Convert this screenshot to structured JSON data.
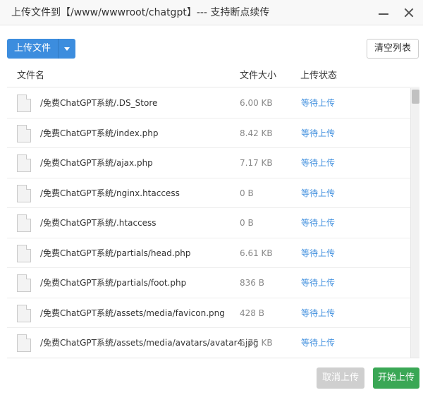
{
  "window": {
    "title": "上传文件到【/www/wwwroot/chatgpt】--- 支持断点续传"
  },
  "toolbar": {
    "upload_label": "上传文件",
    "clear_label": "清空列表"
  },
  "table": {
    "headers": {
      "name": "文件名",
      "size": "文件大小",
      "status": "上传状态"
    },
    "rows": [
      {
        "name": "/免费ChatGPT系统/.DS_Store",
        "size": "6.00 KB",
        "status": "等待上传"
      },
      {
        "name": "/免费ChatGPT系统/index.php",
        "size": "8.42 KB",
        "status": "等待上传"
      },
      {
        "name": "/免费ChatGPT系统/ajax.php",
        "size": "7.17 KB",
        "status": "等待上传"
      },
      {
        "name": "/免费ChatGPT系统/nginx.htaccess",
        "size": "0 B",
        "status": "等待上传"
      },
      {
        "name": "/免费ChatGPT系统/.htaccess",
        "size": "0 B",
        "status": "等待上传"
      },
      {
        "name": "/免费ChatGPT系统/partials/head.php",
        "size": "6.61 KB",
        "status": "等待上传"
      },
      {
        "name": "/免费ChatGPT系统/partials/foot.php",
        "size": "836 B",
        "status": "等待上传"
      },
      {
        "name": "/免费ChatGPT系统/assets/media/favicon.png",
        "size": "428 B",
        "status": "等待上传"
      },
      {
        "name": "/免费ChatGPT系统/assets/media/avatars/avatar4.jpg",
        "size": "6.75 KB",
        "status": "等待上传"
      }
    ]
  },
  "footer": {
    "cancel_label": "取消上传",
    "start_label": "开始上传"
  },
  "colors": {
    "primary": "#3c8dde",
    "success": "#3aa755",
    "disabled": "#cfcfcf"
  }
}
